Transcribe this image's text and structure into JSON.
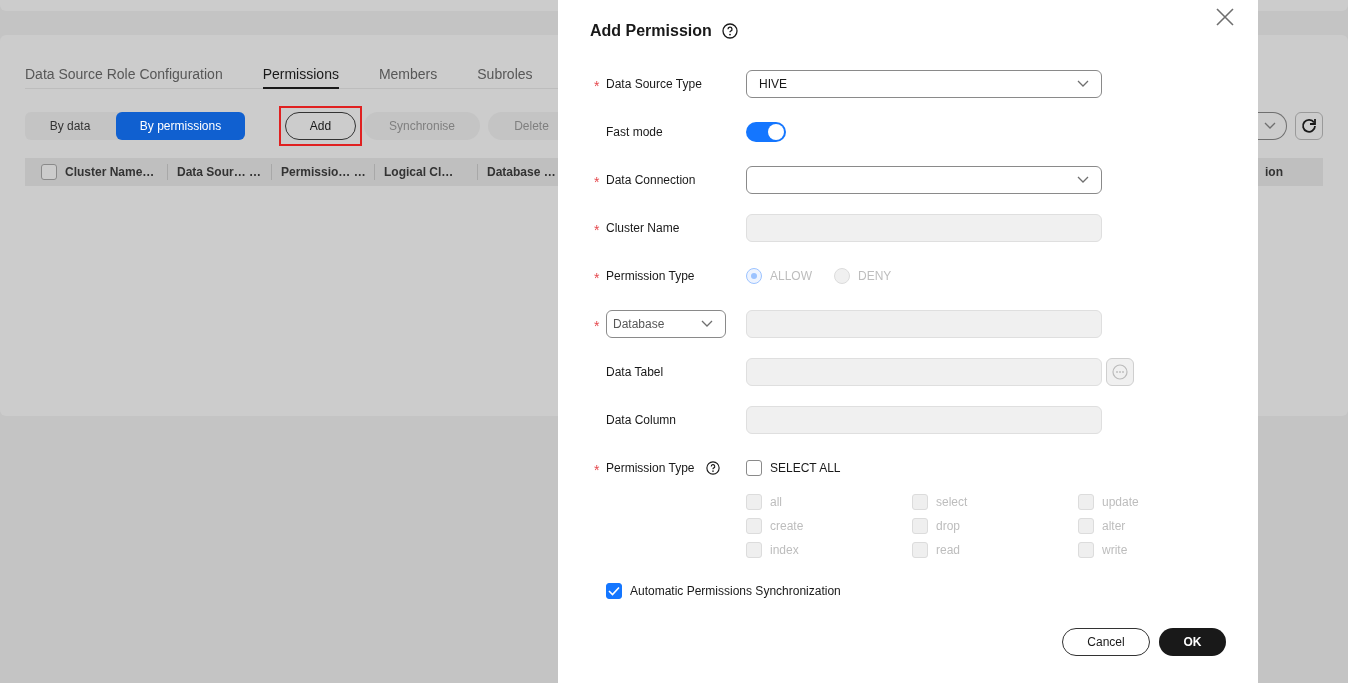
{
  "tabs": [
    {
      "label": "Data Source Role Configuration",
      "selected": false
    },
    {
      "label": "Permissions",
      "selected": true
    },
    {
      "label": "Members",
      "selected": false
    },
    {
      "label": "Subroles",
      "selected": false
    }
  ],
  "view_toggle": [
    {
      "label": "By data",
      "selected": false
    },
    {
      "label": "By permissions",
      "selected": true
    }
  ],
  "toolbar_buttons": [
    {
      "label": "Add",
      "disabled": false,
      "highlighted": true
    },
    {
      "label": "Synchronise",
      "disabled": true,
      "highlighted": false
    },
    {
      "label": "Delete",
      "disabled": true,
      "highlighted": false
    }
  ],
  "table": {
    "all_checked": false,
    "columns": [
      "Cluster Name…",
      "Data Sour… …",
      "Permissio… …",
      "Logical Cl…",
      "Database …"
    ],
    "column_6": "ion"
  },
  "dialog": {
    "title": "Add Permission",
    "fields": [
      {
        "kind": "select",
        "label": "Data Source Type",
        "required_mark": "*",
        "value": "HIVE"
      },
      {
        "kind": "toggle",
        "label": "Fast mode",
        "on": true
      },
      {
        "kind": "select",
        "label": "Data Connection",
        "required_mark": "*"
      },
      {
        "kind": "input",
        "label": "Cluster Name",
        "required_mark": "*",
        "disabled": true
      },
      {
        "kind": "radio",
        "label": "Permission Type",
        "required_mark": "*",
        "disabled": true,
        "options": [
          {
            "label": "ALLOW",
            "selected": true
          },
          {
            "label": "DENY",
            "selected": false
          }
        ]
      },
      {
        "kind": "scope",
        "scope": "Database",
        "required_mark": "*",
        "disabled": true
      },
      {
        "kind": "input-more",
        "label": "Data Tabel",
        "disabled": true
      },
      {
        "kind": "input",
        "label": "Data Column",
        "disabled": true
      },
      {
        "kind": "checkgroup",
        "label": "Permission Type",
        "required_mark": "*",
        "select_all": {
          "label": "SELECT ALL",
          "checked": false
        },
        "options": [
          {
            "label": "all",
            "checked": false,
            "disabled": true
          },
          {
            "label": "select",
            "checked": false,
            "disabled": true
          },
          {
            "label": "update",
            "checked": false,
            "disabled": true
          },
          {
            "label": "create",
            "checked": false,
            "disabled": true
          },
          {
            "label": "drop",
            "checked": false,
            "disabled": true
          },
          {
            "label": "alter",
            "checked": false,
            "disabled": true
          },
          {
            "label": "index",
            "checked": false,
            "disabled": true
          },
          {
            "label": "read",
            "checked": false,
            "disabled": true
          },
          {
            "label": "write",
            "checked": false,
            "disabled": true
          }
        ]
      }
    ],
    "sync": {
      "label": "Automatic Permissions Synchronization",
      "checked": true
    },
    "buttons": [
      {
        "label": "Cancel",
        "kind": "secondary"
      },
      {
        "label": "OK",
        "kind": "primary"
      }
    ]
  }
}
